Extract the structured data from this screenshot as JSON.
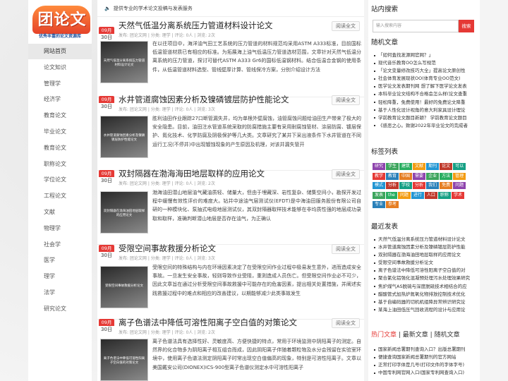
{
  "logo": {
    "text": "团论文",
    "sub": "优秀丰富的论文资源库"
  },
  "nav": [
    "网站首页",
    "论文知识",
    "管理学",
    "经济学",
    "教育论文",
    "毕业论文",
    "教育论文",
    "职称论文",
    "学位论文",
    "工程论文",
    "文献",
    "物理学",
    "社会学",
    "医学",
    "理学",
    "法学",
    "研究论文"
  ],
  "notice": "提供专业的学术论文投稿与发表服务",
  "read_all": "阅读全文",
  "articles": [
    {
      "month": "09月",
      "day": "30日",
      "title": "天然气低温分离系统压力管道材料设计论文",
      "meta": "发布: 团论文网 | 分类: 理学 | 评论: 0人 | 浏览: 2次",
      "thumb": "天然气低温分离系统压力管道材料设计论文",
      "excerpt": "在以往项目中，海洋油气田工艺系统的压力管道的材料规范均采用ASTM A333标准，目前国标低温管道材质已有相应的标准。为拓展海上油气低温压力管道选材范围，文章针对天然气低温分离系统的压力管道，探讨可替代ASTM A333 Gr6的国标低温钢材料。结合低温合金钢的使用条件，从低温管道材料选型、管线壁厚计算、管线保冷方案，分别介绍设计方法"
    },
    {
      "month": "09月",
      "day": "30日",
      "title": "水井管道腐蚀因素分析及镍磷镀层防护性能论文",
      "meta": "发布: 团论文网 | 分类: 理学 | 评论: 0人 | 浏览: 3次",
      "thumb": "水井管道腐蚀因素分析及镍磷镀层防护性能论文",
      "excerpt": "胜利油田作业跟踪27口断管漏失井，均为单根外壁腐蚀，油管腐蚀问题给油田生产带来了极大的安全隐患。目前，油田注水管道系统采取的防腐措施主要有采用耐腐蚀管材、涂层防腐、镀层保护、氮化技术、化学防腐及阴极保护等几大类。文章研究了某井下采出液条件下水井管道在不同运行工况(不停井)中出现镀蚀现象的产生原因及机理，对该井漏失管开"
    },
    {
      "month": "09月",
      "day": "30日",
      "title": "双封隔器在渤海海田地层取样的应用论文",
      "meta": "发布: 团论文网 | 分类: 理学 | 评论: 0人 | 浏览: 2次",
      "thumb": "双封隔器在渤海油田地层取样的应用论文",
      "excerpt": "渤海油田潜山地层油气藏油质轻、储量大，但由于埋藏深、岩性复杂、储集空间小，勘探开发过程中缓慢有效性评价的难度大。钻井中途油气层测试仪(EFDT)是中海油田服务股份有限公司自研的一种模块化、泵抽式电缆地层测试仪，其双封隔器取样技术能够在非均质性强的地层成功录取和取样，准确判断潜山地层是否存在油气，为正确认"
    },
    {
      "month": "09月",
      "day": "30日",
      "title": "受限空间事故救援分析论文",
      "meta": "发布: 团论文网 | 分类: 理学 | 评论: 0人 | 浏览: 3次",
      "thumb": "受限空间事故救援分析论文",
      "excerpt": "受限空间的特殊结构与内在环境因素决定了在受限空间作业过程中极易发生意外，进而造成安全事故。一旦发生安全事故，轻则导致作业受阻，重则造成人员伤亡。但受限空间作业必不可少，因此文章旨在通过分析受限空间事故救援中可能存在的危害因素，提出相关处置措施，并阐述实践救援过程中的难点和相应的改善建议，以期能够减少此类事故发生"
    },
    {
      "month": "09月",
      "day": "30日",
      "title": "离子色谱法中降低可溶性阳离子空白值的对策论文",
      "meta": "发布: 团论文网 | 分类: 理学 | 评论: 0人 | 浏览: 2次",
      "thumb": "离子色谱法中降低可溶性阳离子空白值的对策论文",
      "excerpt": "离子色谱法具有选择性好、灵敏度高、方便快捷的特点，常用于环境监测中阴阳离子的测定。自然界的化合物多为阴阳离子相互组合而成，因此阴阳离子伴随着颗粒物及水分会残留在实验室环境中，使用离子色谱法测定阴阳离子时常出现空白值偏高的现象，特别是可溶性阳离子。文章以美国戴安公司(DIONEX)ICS-900型离子色谱仪测定水中可溶性阳离子"
    }
  ],
  "right": {
    "search_title": "站内搜索",
    "search_placeholder": "输入搜索内容",
    "search_btn": "搜索",
    "random_title": "随机文章",
    "random": [
      "「如何査找发源网官网？」",
      "现代音乐教育OO怎么写规范",
      "「论文变量修改技巧大全」提高论文原创性",
      "社会体育发展现状OO(体育专业OO范文)",
      "医学论文发表期刊网 想了解下医学论文发表",
      "本科毕业论文结构不合格会怎么样(论文查重",
      "轻松降重，免费使用！最好的免费论文降重",
      "基于人性化设计视角的意大利家具设计理论",
      "学前教育论文题目新颖？ 学前教育论文题目",
      "《惑恶之心。致谢2022年毕业论文的完成者"
    ],
    "tags_title": "标签列表",
    "tags": [
      "研究",
      "学生",
      "建筑",
      "文献",
      "期刊",
      "论文",
      "可以",
      "教学",
      "教育",
      "中国",
      "需要",
      "企业",
      "方法",
      "管理",
      "模式",
      "分析",
      "学校",
      "分析",
      "我们",
      "免费",
      "问题",
      "发表",
      "the",
      "问题",
      "进行",
      "人口",
      "职称",
      "学术",
      "专业",
      "参考"
    ],
    "latest_title": "最近发表",
    "latest": [
      "天然气低温分离系统压力管道材料设计论文",
      "水井管道腐蚀因素分析及镍磷镀层防护性能",
      "双封隔器在渤海油田地层取样的应用论文",
      "受限空间事故救援分析论文",
      "离子色谱法中降低可溶性阳离子空白值的对",
      "聚合氯化铝强化混凝预处理污水处理效果研究",
      "焦炉煤气AS脱硫与深度脱硫技术相结合的应",
      "醋酸管式加热炉氮氧化物排放控制技术优化",
      "基于自编码器的切机机组降异常辨识研究论",
      "某海上油田低压气回收流程的设计与应用论"
    ],
    "hot_tabs": [
      "热门文章",
      "最新文章",
      "随机文章"
    ],
    "hot": [
      "国家新闻总署期刊查询入口？出版总署期刊",
      "便捷查询国家新闻总署期刊的官方网站",
      "正常打印字体是几号(打印文件的字体字号)",
      "中国专利网官网入口(国家专利网查询入口)"
    ]
  },
  "colors": {
    "accent": "#e53935"
  }
}
